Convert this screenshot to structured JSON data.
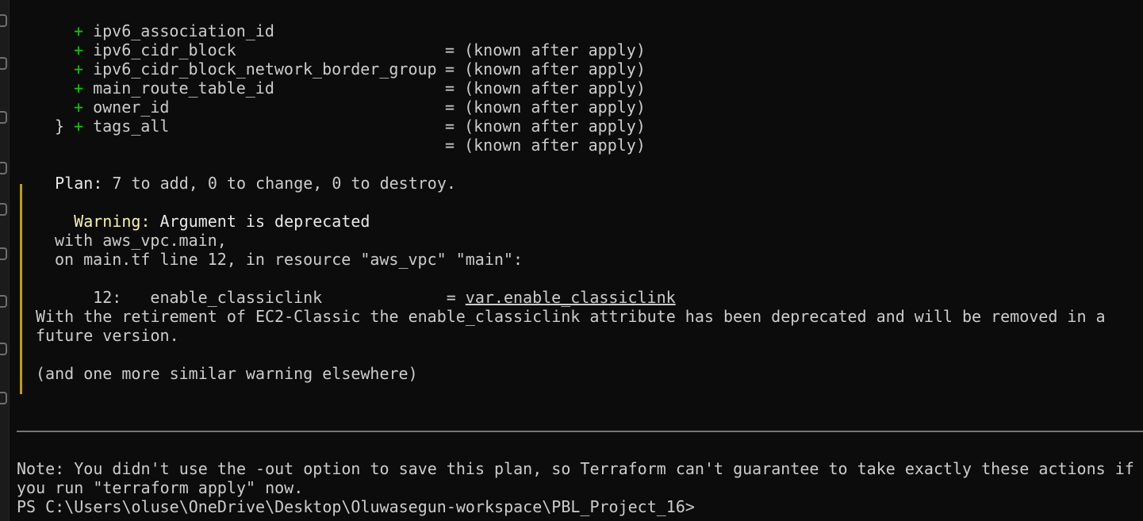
{
  "attributes": [
    {
      "name": "ipv6_association_id",
      "value": "= (known after apply)"
    },
    {
      "name": "ipv6_cidr_block",
      "value": "= (known after apply)"
    },
    {
      "name": "ipv6_cidr_block_network_border_group",
      "value": "= (known after apply)"
    },
    {
      "name": "main_route_table_id",
      "value": "= (known after apply)"
    },
    {
      "name": "owner_id",
      "value": "= (known after apply)"
    },
    {
      "name": "tags_all",
      "value": "= (known after apply)"
    }
  ],
  "plus_sign": "+",
  "closing_brace": "}",
  "plan": {
    "label": "Plan:",
    "summary": " 7 to add, 0 to change, 0 to destroy."
  },
  "warning": {
    "label": "Warning:",
    "title": " Argument is deprecated",
    "with_line": "with aws_vpc.main,",
    "on_line": "on main.tf line 12, in resource \"aws_vpc\" \"main\":",
    "code_prefix": "12:   enable_classiclink             = ",
    "code_link": "var.enable_classiclink",
    "message_line1": "With the retirement of EC2-Classic the enable_classiclink attribute has been deprecated and will be removed in a",
    "message_line2": "future version.",
    "extra": "(and one more similar warning elsewhere)"
  },
  "note": {
    "line1": "Note: You didn't use the -out option to save this plan, so Terraform can't guarantee to take exactly these actions if",
    "line2": "you run \"terraform apply\" now."
  },
  "prompt": "PS C:\\Users\\oluse\\OneDrive\\Desktop\\Oluwasegun-workspace\\PBL_Project_16>",
  "colors": {
    "background": "#0c0c0c",
    "text": "#cccccc",
    "plus": "#16c60c",
    "warning_label": "#f9f1a5",
    "warning_bar": "#c19c00"
  }
}
